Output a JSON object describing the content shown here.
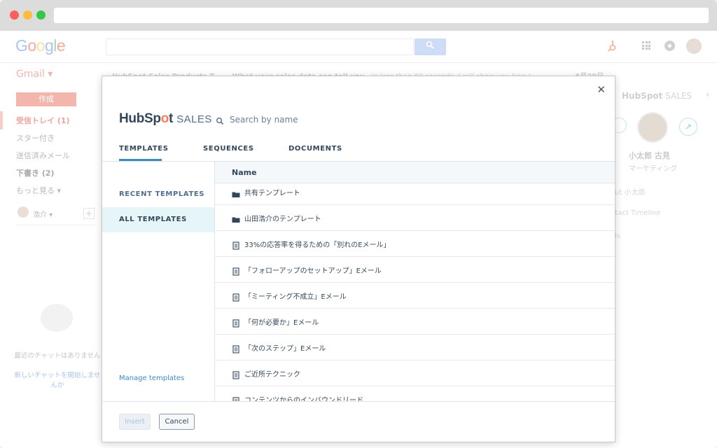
{
  "browser": {
    "address_value": ""
  },
  "gmail": {
    "logo": "Google",
    "gmail_label": "Gmail ▾",
    "compose": "作成",
    "nav": [
      "受信トレイ (1)",
      "スター付き",
      "送信済みメール",
      "下書き (2)",
      "もっと見る ▾"
    ],
    "user": "浩介 ▾",
    "chat_empty": "最近のチャットはありません",
    "chat_link": "新しいチャットを開始しませんか",
    "email_row": {
      "sender": "HubSpot Sales Products T",
      "subject": "What your sales data can tell you",
      "snippet": " - In less than 60 seconds, I will show you how I",
      "date": "6月20日"
    },
    "right_panel": {
      "brand": "HubSpot",
      "brand_suffix": "SALES",
      "contact_name": "小太郎 古見",
      "contact_role": "マーケティング",
      "items": [
        "out 小太郎",
        "ntact Timeline",
        "als"
      ]
    }
  },
  "modal": {
    "brand_hub": "HubSp",
    "brand_o": "o",
    "brand_t": "t",
    "brand_sales": "SALES",
    "close_icon": "close-icon",
    "search": {
      "placeholder": "Search by name",
      "value": ""
    },
    "tabs": [
      "TEMPLATES",
      "SEQUENCES",
      "DOCUMENTS"
    ],
    "active_tab": "TEMPLATES",
    "sidebar": {
      "items": [
        "RECENT TEMPLATES",
        "ALL TEMPLATES"
      ],
      "active": "ALL TEMPLATES",
      "manage_link": "Manage templates"
    },
    "list": {
      "header": "Name",
      "rows": [
        {
          "icon": "folder-icon",
          "name": "共有テンプレート"
        },
        {
          "icon": "folder-icon",
          "name": "山田浩介のテンプレート"
        },
        {
          "icon": "document-icon",
          "name": "33%の応答率を得るための「別れのEメール」"
        },
        {
          "icon": "document-icon",
          "name": "「フォローアップのセットアップ」Eメール"
        },
        {
          "icon": "document-icon",
          "name": "「ミーティング不成立」Eメール"
        },
        {
          "icon": "document-icon",
          "name": "「何が必要か」Eメール"
        },
        {
          "icon": "document-icon",
          "name": "「次のステップ」Eメール"
        },
        {
          "icon": "document-icon",
          "name": "ご近所テクニック"
        },
        {
          "icon": "document-icon",
          "name": "コンテンツからのインバウンドリード"
        }
      ]
    },
    "footer": {
      "insert": "Insert",
      "cancel": "Cancel"
    }
  },
  "colors": {
    "accent": "#3d8cc5",
    "hubspot_orange": "#ff7a59",
    "text": "#33475b",
    "active_bg": "#e5f5f8"
  }
}
